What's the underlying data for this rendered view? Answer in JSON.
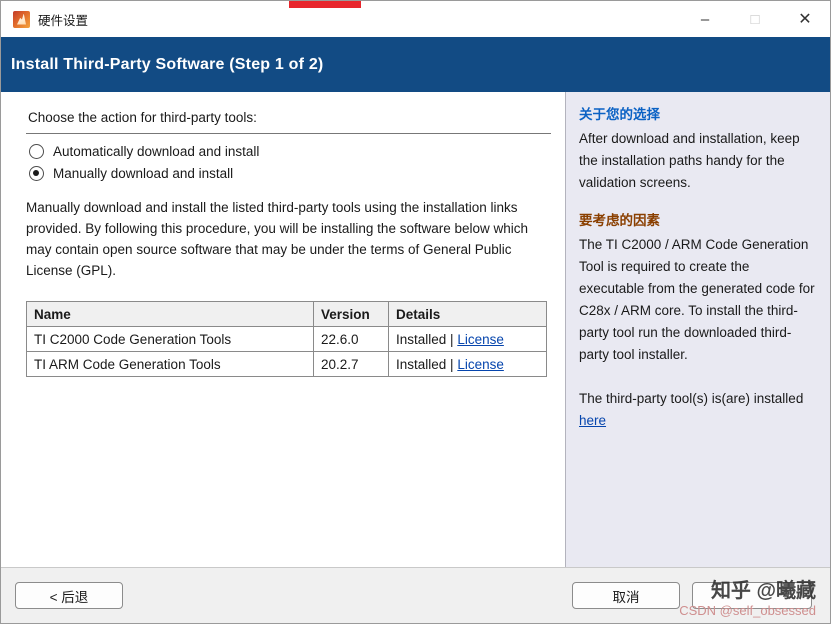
{
  "window": {
    "title": "硬件设置",
    "controls": {
      "minimize": "–",
      "maximize": "□",
      "close": "✕"
    }
  },
  "header": {
    "title": "Install Third-Party Software (Step 1 of 2)"
  },
  "main": {
    "prompt": "Choose the action for third-party tools:",
    "radios": [
      {
        "label": "Automatically download and install",
        "selected": false
      },
      {
        "label": "Manually download and install",
        "selected": true
      }
    ],
    "description": "Manually download and install the listed third-party tools using the installation links provided. By following this procedure, you will be installing the software below which may contain open source software that may be under the terms of General Public License (GPL).",
    "table": {
      "headers": [
        "Name",
        "Version",
        "Details"
      ],
      "rows": [
        {
          "name": "TI C2000 Code Generation Tools",
          "version": "22.6.0",
          "status": "Installed",
          "sep": " | ",
          "link": "License"
        },
        {
          "name": "TI ARM Code Generation Tools",
          "version": "20.2.7",
          "status": "Installed",
          "sep": " | ",
          "link": "License"
        }
      ]
    }
  },
  "sidebar": {
    "section1": {
      "title": "关于您的选择",
      "body": "After download and installation, keep the installation paths handy for the validation screens."
    },
    "section2": {
      "title": "要考虑的因素",
      "body": "The TI C2000 / ARM Code Generation Tool is required to create the executable from the generated code for C28x / ARM core. To install the third-party tool run the downloaded third-party tool installer."
    },
    "installed_note": {
      "prefix": "The third-party tool(s) is(are) installed ",
      "link": "here"
    }
  },
  "footer": {
    "back": "< 后退",
    "cancel": "取消",
    "next": ""
  },
  "watermark": {
    "line1": "知乎 @曦藏",
    "line2": "CSDN @self_obsessed"
  },
  "colors": {
    "header_bg": "#124b84",
    "sidebar_bg": "#e9e9f2",
    "section1_title": "#0b62c4",
    "section2_title": "#8a3f00",
    "link": "#0645ad",
    "banner_artifact": "#e8262d"
  }
}
